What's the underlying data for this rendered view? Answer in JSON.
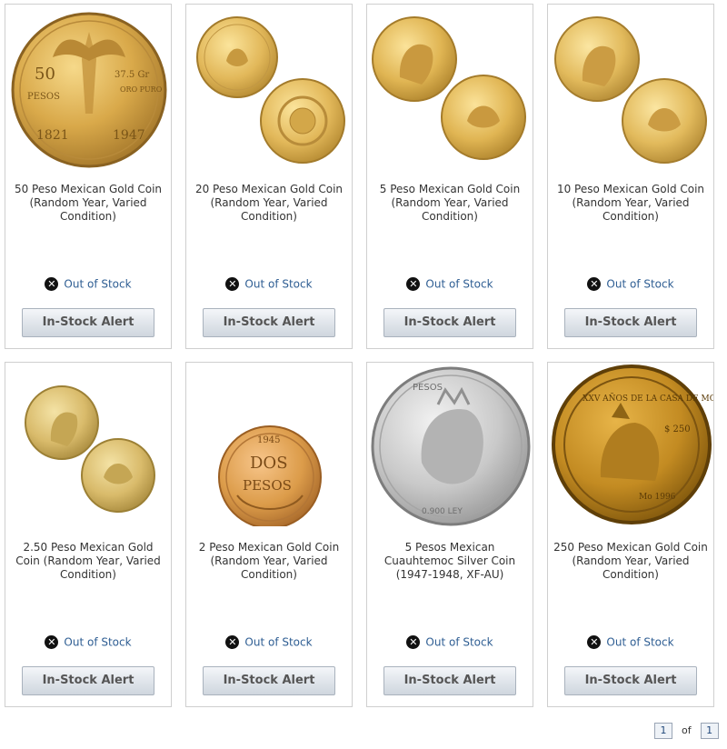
{
  "products": [
    {
      "name": "50 Peso Mexican Gold Coin (Random Year, Varied Condition)",
      "status": "Out of Stock",
      "button": "In-Stock Alert"
    },
    {
      "name": "20 Peso Mexican Gold Coin (Random Year, Varied Condition)",
      "status": "Out of Stock",
      "button": "In-Stock Alert"
    },
    {
      "name": "5 Peso Mexican Gold Coin (Random Year, Varied Condition)",
      "status": "Out of Stock",
      "button": "In-Stock Alert"
    },
    {
      "name": "10 Peso Mexican Gold Coin (Random Year, Varied Condition)",
      "status": "Out of Stock",
      "button": "In-Stock Alert"
    },
    {
      "name": "2.50 Peso Mexican Gold Coin (Random Year, Varied Condition)",
      "status": "Out of Stock",
      "button": "In-Stock Alert"
    },
    {
      "name": "2 Peso Mexican Gold Coin (Random Year, Varied Condition)",
      "status": "Out of Stock",
      "button": "In-Stock Alert"
    },
    {
      "name": "5 Pesos Mexican Cuauhtemoc Silver Coin (1947-1948, XF-AU)",
      "status": "Out of Stock",
      "button": "In-Stock Alert"
    },
    {
      "name": "250 Peso Mexican Gold Coin (Random Year, Varied Condition)",
      "status": "Out of Stock",
      "button": "In-Stock Alert"
    }
  ],
  "coin_text": {
    "c1_left": "50",
    "c1_pesos": "PESOS",
    "c1_right": "37.5 Gr",
    "c1_oro": "ORO PURO",
    "c1_year_l": "1821",
    "c1_year_r": "1947",
    "c6_year": "1945",
    "c6_dos": "DOS",
    "c6_pesos": "PESOS",
    "c7_top": "PESOS",
    "c7_bottom": "0.900 LEY",
    "c8_top": "XXV AÑOS DE LA CASA DE MONEDA",
    "c8_val": "$ 250",
    "c8_mark": "Mo 1996"
  },
  "icons": {
    "status": "x-circle-icon"
  },
  "pagination": {
    "current": "1",
    "of": "of",
    "total": "1"
  }
}
